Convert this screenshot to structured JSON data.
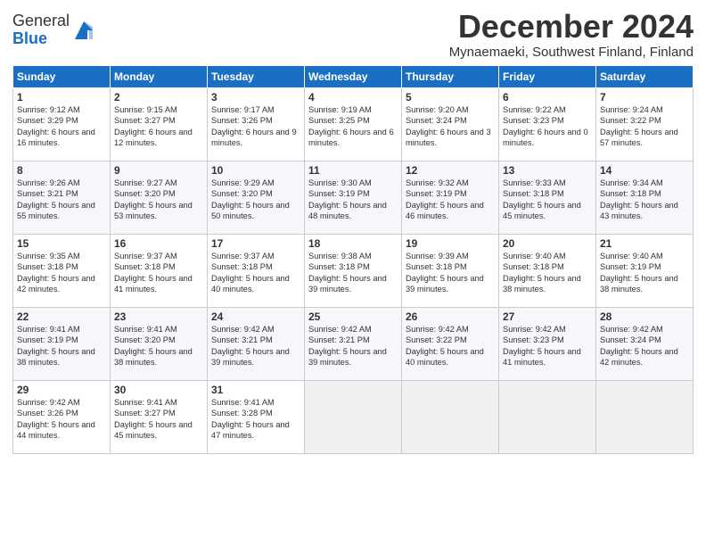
{
  "logo": {
    "general": "General",
    "blue": "Blue"
  },
  "header": {
    "month_title": "December 2024",
    "location": "Mynaemaeki, Southwest Finland, Finland"
  },
  "weekdays": [
    "Sunday",
    "Monday",
    "Tuesday",
    "Wednesday",
    "Thursday",
    "Friday",
    "Saturday"
  ],
  "weeks": [
    [
      {
        "day": "1",
        "sunrise": "9:12 AM",
        "sunset": "3:29 PM",
        "daylight": "6 hours and 16 minutes."
      },
      {
        "day": "2",
        "sunrise": "9:15 AM",
        "sunset": "3:27 PM",
        "daylight": "6 hours and 12 minutes."
      },
      {
        "day": "3",
        "sunrise": "9:17 AM",
        "sunset": "3:26 PM",
        "daylight": "6 hours and 9 minutes."
      },
      {
        "day": "4",
        "sunrise": "9:19 AM",
        "sunset": "3:25 PM",
        "daylight": "6 hours and 6 minutes."
      },
      {
        "day": "5",
        "sunrise": "9:20 AM",
        "sunset": "3:24 PM",
        "daylight": "6 hours and 3 minutes."
      },
      {
        "day": "6",
        "sunrise": "9:22 AM",
        "sunset": "3:23 PM",
        "daylight": "6 hours and 0 minutes."
      },
      {
        "day": "7",
        "sunrise": "9:24 AM",
        "sunset": "3:22 PM",
        "daylight": "5 hours and 57 minutes."
      }
    ],
    [
      {
        "day": "8",
        "sunrise": "9:26 AM",
        "sunset": "3:21 PM",
        "daylight": "5 hours and 55 minutes."
      },
      {
        "day": "9",
        "sunrise": "9:27 AM",
        "sunset": "3:20 PM",
        "daylight": "5 hours and 53 minutes."
      },
      {
        "day": "10",
        "sunrise": "9:29 AM",
        "sunset": "3:20 PM",
        "daylight": "5 hours and 50 minutes."
      },
      {
        "day": "11",
        "sunrise": "9:30 AM",
        "sunset": "3:19 PM",
        "daylight": "5 hours and 48 minutes."
      },
      {
        "day": "12",
        "sunrise": "9:32 AM",
        "sunset": "3:19 PM",
        "daylight": "5 hours and 46 minutes."
      },
      {
        "day": "13",
        "sunrise": "9:33 AM",
        "sunset": "3:18 PM",
        "daylight": "5 hours and 45 minutes."
      },
      {
        "day": "14",
        "sunrise": "9:34 AM",
        "sunset": "3:18 PM",
        "daylight": "5 hours and 43 minutes."
      }
    ],
    [
      {
        "day": "15",
        "sunrise": "9:35 AM",
        "sunset": "3:18 PM",
        "daylight": "5 hours and 42 minutes."
      },
      {
        "day": "16",
        "sunrise": "9:37 AM",
        "sunset": "3:18 PM",
        "daylight": "5 hours and 41 minutes."
      },
      {
        "day": "17",
        "sunrise": "9:37 AM",
        "sunset": "3:18 PM",
        "daylight": "5 hours and 40 minutes."
      },
      {
        "day": "18",
        "sunrise": "9:38 AM",
        "sunset": "3:18 PM",
        "daylight": "5 hours and 39 minutes."
      },
      {
        "day": "19",
        "sunrise": "9:39 AM",
        "sunset": "3:18 PM",
        "daylight": "5 hours and 39 minutes."
      },
      {
        "day": "20",
        "sunrise": "9:40 AM",
        "sunset": "3:18 PM",
        "daylight": "5 hours and 38 minutes."
      },
      {
        "day": "21",
        "sunrise": "9:40 AM",
        "sunset": "3:19 PM",
        "daylight": "5 hours and 38 minutes."
      }
    ],
    [
      {
        "day": "22",
        "sunrise": "9:41 AM",
        "sunset": "3:19 PM",
        "daylight": "5 hours and 38 minutes."
      },
      {
        "day": "23",
        "sunrise": "9:41 AM",
        "sunset": "3:20 PM",
        "daylight": "5 hours and 38 minutes."
      },
      {
        "day": "24",
        "sunrise": "9:42 AM",
        "sunset": "3:21 PM",
        "daylight": "5 hours and 39 minutes."
      },
      {
        "day": "25",
        "sunrise": "9:42 AM",
        "sunset": "3:21 PM",
        "daylight": "5 hours and 39 minutes."
      },
      {
        "day": "26",
        "sunrise": "9:42 AM",
        "sunset": "3:22 PM",
        "daylight": "5 hours and 40 minutes."
      },
      {
        "day": "27",
        "sunrise": "9:42 AM",
        "sunset": "3:23 PM",
        "daylight": "5 hours and 41 minutes."
      },
      {
        "day": "28",
        "sunrise": "9:42 AM",
        "sunset": "3:24 PM",
        "daylight": "5 hours and 42 minutes."
      }
    ],
    [
      {
        "day": "29",
        "sunrise": "9:42 AM",
        "sunset": "3:26 PM",
        "daylight": "5 hours and 44 minutes."
      },
      {
        "day": "30",
        "sunrise": "9:41 AM",
        "sunset": "3:27 PM",
        "daylight": "5 hours and 45 minutes."
      },
      {
        "day": "31",
        "sunrise": "9:41 AM",
        "sunset": "3:28 PM",
        "daylight": "5 hours and 47 minutes."
      },
      null,
      null,
      null,
      null
    ]
  ]
}
